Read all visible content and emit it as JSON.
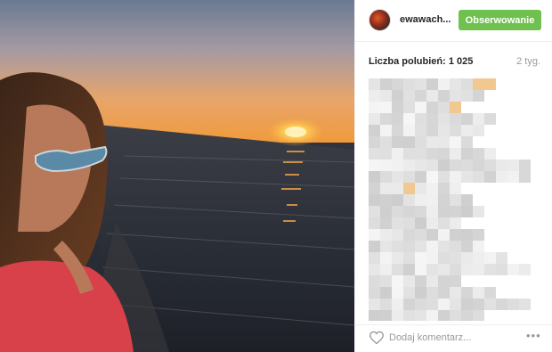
{
  "post": {
    "username": "ewawach...",
    "follow_label": "Obserwowanie",
    "likes_text": "Liczba polubień: 1 025",
    "time_ago": "2 tyg.",
    "comment_placeholder": "Dodaj komentarz...",
    "more_icon": "more-options-icon",
    "like_icon": "heart-icon",
    "comments_obscured": true
  },
  "colors": {
    "follow_button": "#70c050",
    "text": "#262626",
    "muted": "#999999",
    "divider": "#efefef",
    "blur_tint": "#f0c890"
  }
}
